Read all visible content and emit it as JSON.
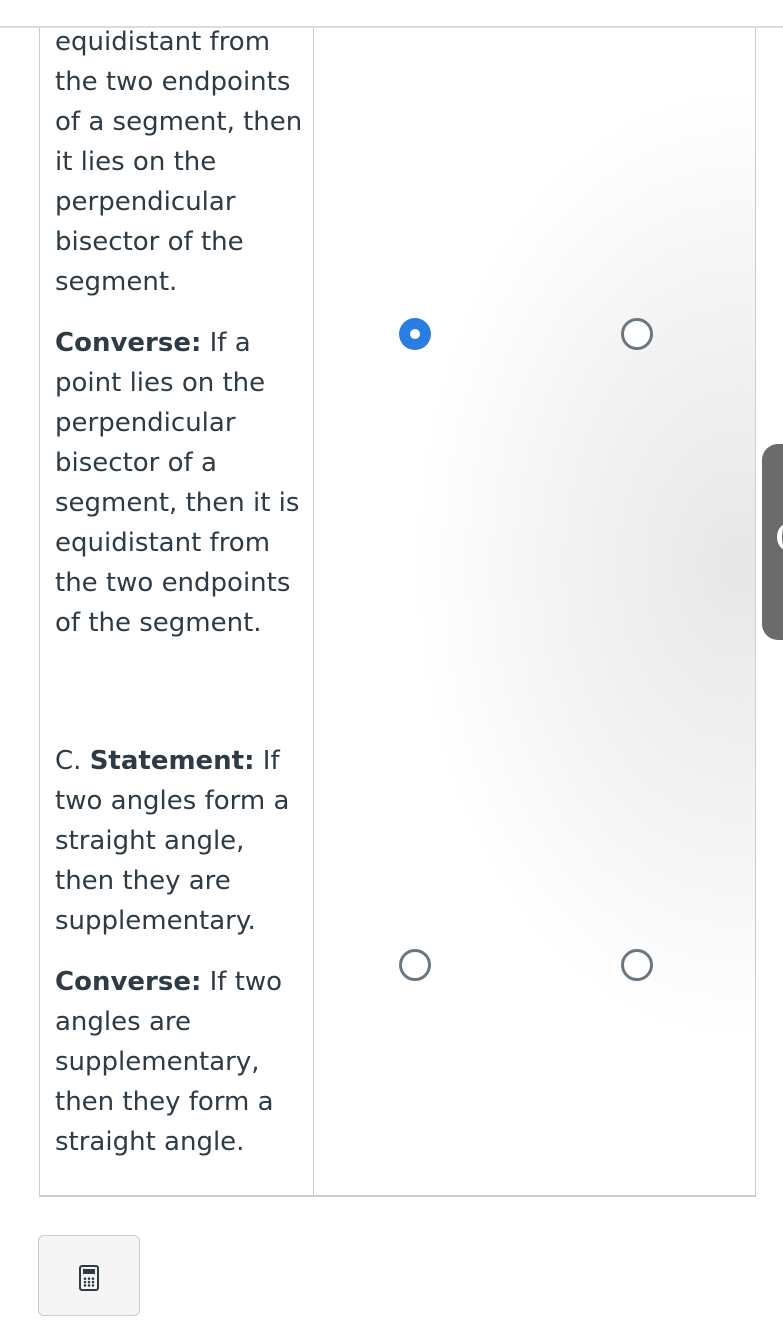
{
  "row_b": {
    "statement_tail": "equidistant from the two endpoints of a segment, then it lies on the perpendicular bisector of the segment.",
    "converse_label": "Converse:",
    "converse_text": " If a point lies on the perpendicular bisector of a segment, then it is equidistant from the two endpoints of the segment.",
    "col1_selected": true,
    "col2_selected": false
  },
  "row_c": {
    "letter": "C. ",
    "statement_label": "Statement:",
    "statement_text": " If two angles form a straight angle, then they are supplementary.",
    "converse_label": "Converse:",
    "converse_text": " If two angles are supplementary, then they form a straight angle.",
    "col1_selected": false,
    "col2_selected": false
  },
  "icons": {
    "calculator": "calculator-icon",
    "side_panel": "chevron-left-icon"
  },
  "colors": {
    "radio_selected": "#2a7de1",
    "radio_unselected_border": "#6b7780",
    "text": "#2d3b45",
    "border": "#c9cdd1"
  }
}
